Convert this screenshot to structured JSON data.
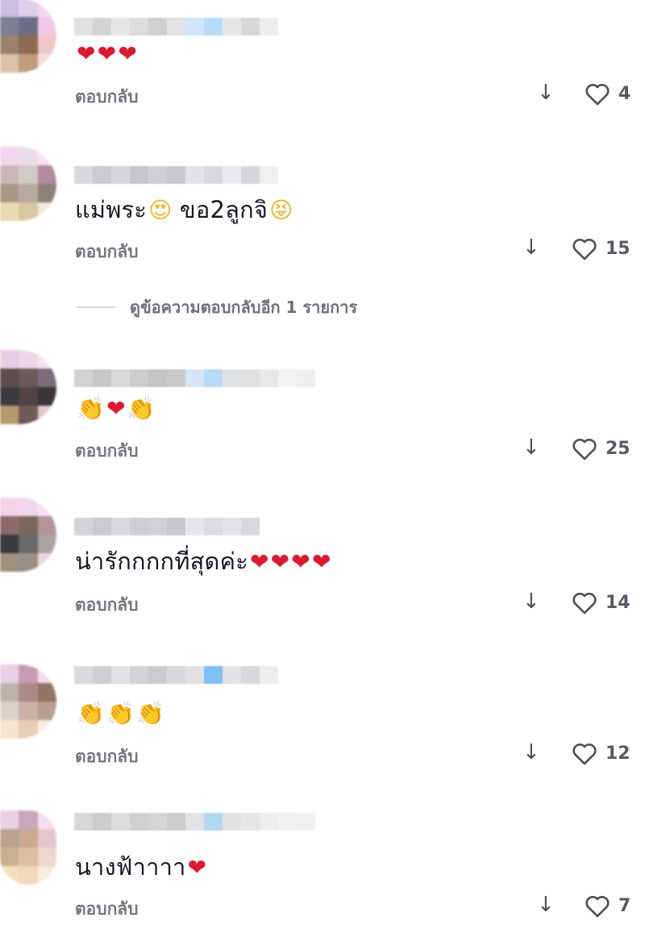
{
  "reply_label": "ตอบกลับ",
  "more_replies_label": "ดูข้อความตอบกลับอีก 1 รายการ",
  "colors": {
    "heart_red": "#e0182d",
    "secondary_text": "#757780",
    "like_count": "#595a62"
  },
  "comments": [
    {
      "username": "(blurred)",
      "text": "",
      "emojis": [
        "heart",
        "heart",
        "heart"
      ],
      "like_count": "4"
    },
    {
      "username": "(blurred)",
      "text_part1": "แม่พระ",
      "text_part2": " ขอ2ลูกจิ",
      "emojis": [
        "heart-eyes",
        "squint-tongue"
      ],
      "like_count": "15"
    },
    {
      "username": "(blurred)",
      "text": "",
      "emojis": [
        "clap",
        "heart",
        "clap"
      ],
      "like_count": "25"
    },
    {
      "username": "(blurred)",
      "text": "น่ารักกกกที่สุดค่ะ",
      "emojis": [
        "heart",
        "heart",
        "heart",
        "heart"
      ],
      "like_count": "14"
    },
    {
      "username": "(blurred)",
      "text": "",
      "emojis": [
        "clap",
        "clap",
        "clap"
      ],
      "like_count": "12"
    },
    {
      "username": "(blurred)",
      "text": "นางฟ้าาาา",
      "emojis": [
        "heart"
      ],
      "like_count": "7"
    }
  ]
}
